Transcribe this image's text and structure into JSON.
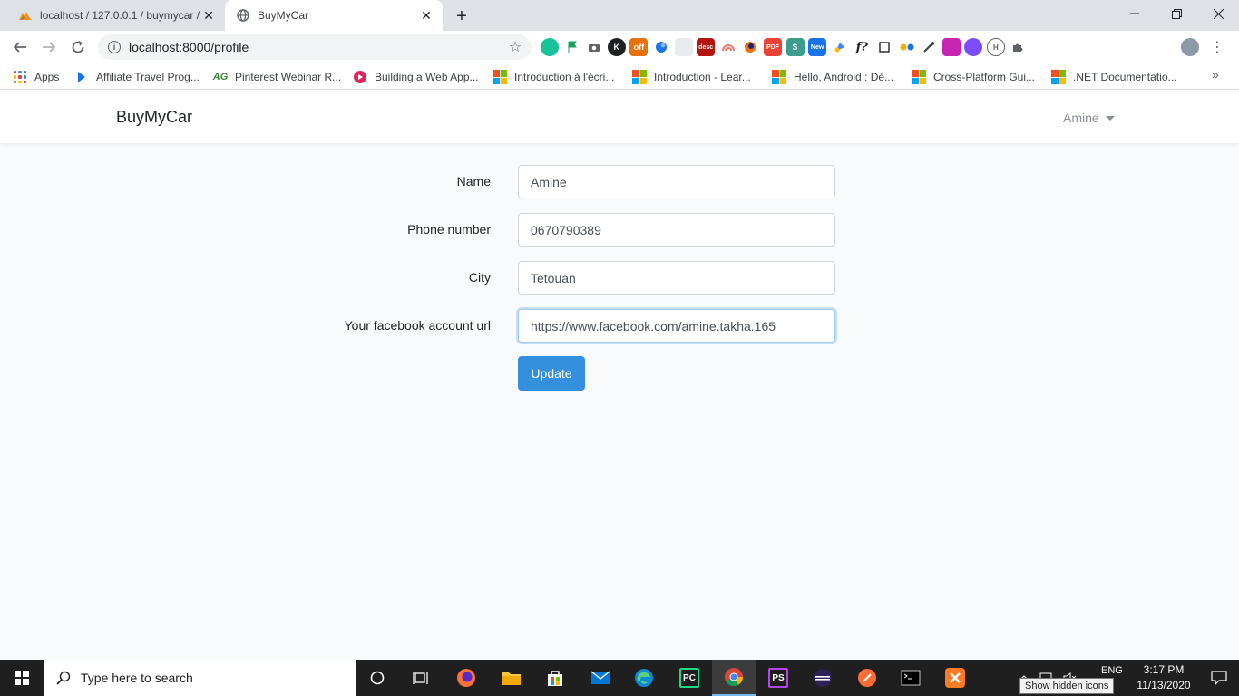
{
  "browser": {
    "tabs": [
      {
        "title": "localhost / 127.0.0.1 / buymycar /",
        "icon": "phpmyadmin-icon",
        "active": false
      },
      {
        "title": "BuyMyCar",
        "icon": "globe-icon",
        "active": true
      }
    ],
    "new_tab": "+",
    "url": "localhost:8000/profile",
    "bookmarks": [
      {
        "label": "Apps",
        "icon": "apps-grid-icon"
      },
      {
        "label": "Affiliate Travel Prog...",
        "icon": "travel-icon"
      },
      {
        "label": "Pinterest Webinar R...",
        "icon": "ag-icon",
        "icon_text": "AG"
      },
      {
        "label": "Building a Web App...",
        "icon": "play-icon"
      },
      {
        "label": "Introduction à l'écri...",
        "icon": "microsoft-icon"
      },
      {
        "label": "Introduction - Lear...",
        "icon": "microsoft-icon"
      },
      {
        "label": "Hello, Android : Dé...",
        "icon": "microsoft-icon"
      },
      {
        "label": "Cross-Platform Gui...",
        "icon": "microsoft-icon"
      },
      {
        "label": ".NET Documentatio...",
        "icon": "microsoft-icon"
      }
    ],
    "extension_badges": {
      "off": "off",
      "desc": "desc",
      "new": "New",
      "fx": "f?"
    }
  },
  "app": {
    "brand": "BuyMyCar",
    "user_name": "Amine"
  },
  "form": {
    "name_label": "Name",
    "name_value": "Amine",
    "phone_label": "Phone number",
    "phone_value": "0670790389",
    "city_label": "City",
    "city_value": "Tetouan",
    "facebook_label": "Your facebook account url",
    "facebook_value": "https://www.facebook.com/amine.takha.165",
    "submit_label": "Update"
  },
  "taskbar": {
    "search_placeholder": "Type here to search",
    "language": "ENG",
    "time": "3:17 PM",
    "date": "11/13/2020",
    "tooltip": "Show hidden icons"
  },
  "colors": {
    "primary": "#3490dc",
    "page_bg": "#f8fafc",
    "taskbar_bg": "#1f1f1f"
  }
}
